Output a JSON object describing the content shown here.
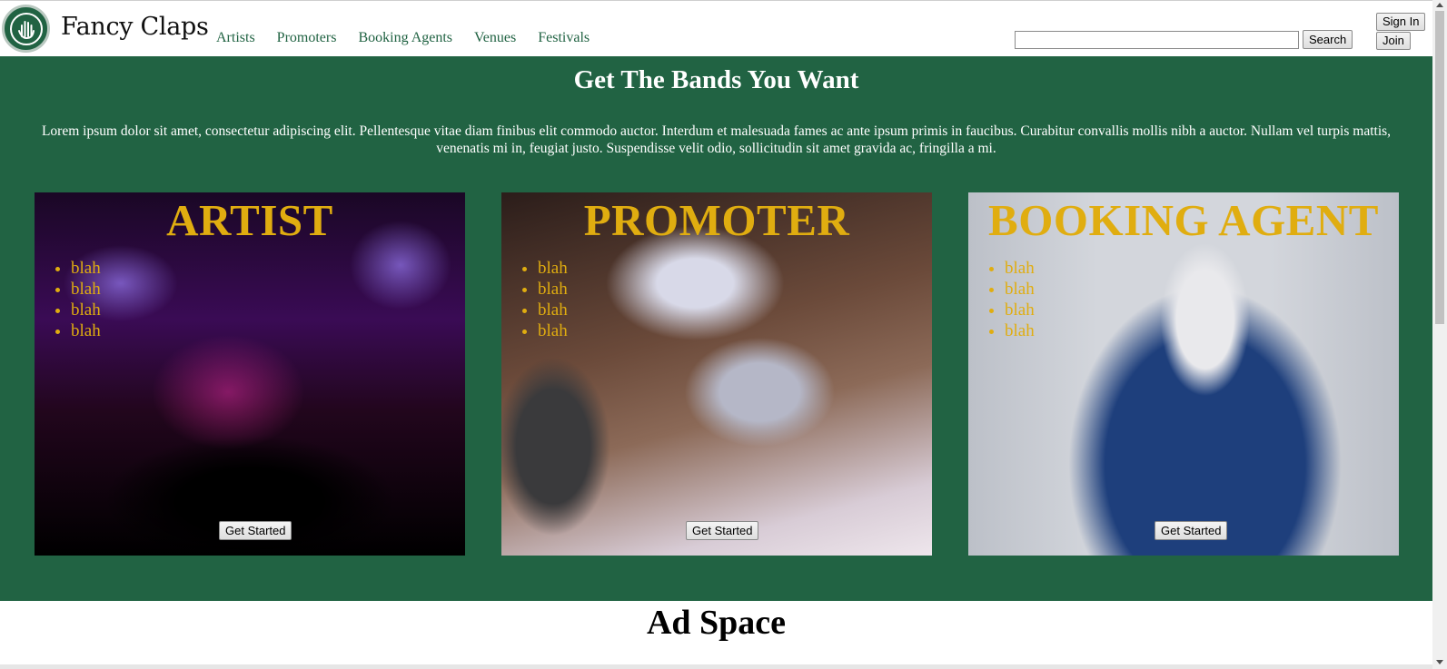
{
  "header": {
    "brand": "Fancy Claps",
    "nav": [
      "Artists",
      "Promoters",
      "Booking Agents",
      "Venues",
      "Festivals"
    ],
    "search": {
      "value": "",
      "placeholder": "",
      "button": "Search"
    },
    "sign_in": "Sign In",
    "join": "Join"
  },
  "hero": {
    "title": "Get The Bands You Want",
    "text": "Lorem ipsum dolor sit amet, consectetur adipiscing elit. Pellentesque vitae diam finibus elit commodo auctor. Interdum et malesuada fames ac ante ipsum primis in faucibus. Curabitur convallis mollis nibh a auctor. Nullam vel turpis mattis, venenatis mi in, feugiat justo. Suspendisse velit odio, sollicitudin sit amet gravida ac, fringilla a mi.",
    "cards": [
      {
        "title": "ARTIST",
        "items": [
          "blah",
          "blah",
          "blah",
          "blah"
        ],
        "button": "Get Started"
      },
      {
        "title": "PROMOTER",
        "items": [
          "blah",
          "blah",
          "blah",
          "blah"
        ],
        "button": "Get Started"
      },
      {
        "title": "BOOKING AGENT",
        "items": [
          "blah",
          "blah",
          "blah",
          "blah"
        ],
        "button": "Get Started"
      }
    ]
  },
  "ad": {
    "title": "Ad Space"
  },
  "colors": {
    "brand_green": "#216343",
    "accent_gold": "#e0ad10"
  },
  "icons": {
    "logo": "clapping-hands-logo-icon"
  }
}
